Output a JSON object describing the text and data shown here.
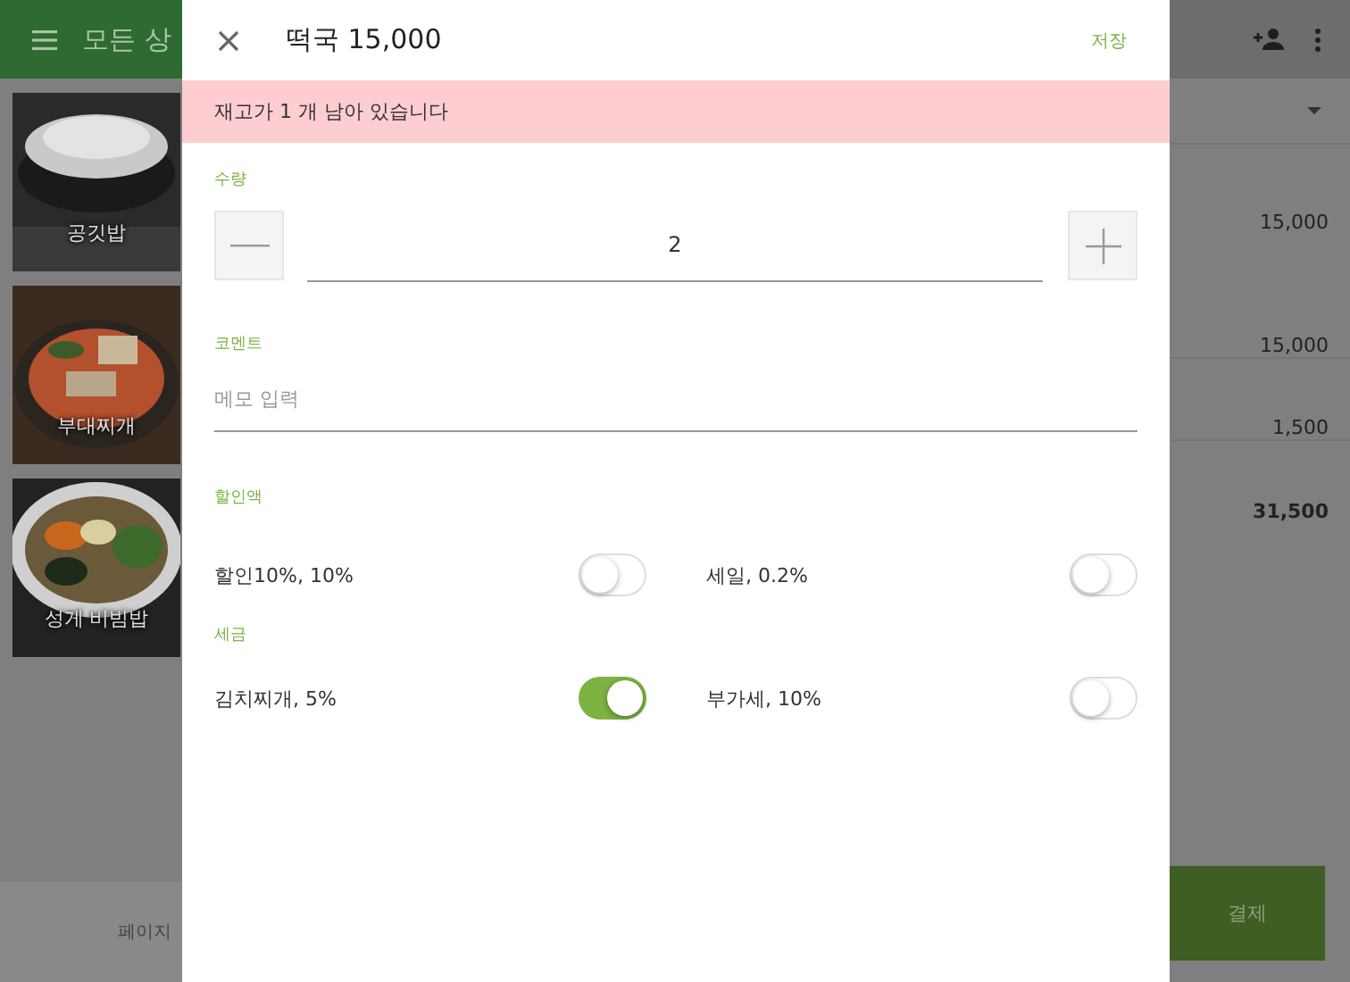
{
  "background": {
    "app_title": "모든 상",
    "products": [
      {
        "name": "공깃밥"
      },
      {
        "name": "부대찌개"
      },
      {
        "name": "성게 비빔밥"
      }
    ],
    "page_label": "페이지",
    "amounts": [
      "15,000",
      "15,000",
      "1,500"
    ],
    "total": "31,500",
    "pay_button": "결제"
  },
  "dialog": {
    "title": "떡국 15,000",
    "save": "저장",
    "stock_notice": "재고가 1 개 남아 있습니다",
    "quantity": {
      "label": "수량",
      "value": "2"
    },
    "comment": {
      "label": "코멘트",
      "placeholder": "메모 입력"
    },
    "sections": [
      {
        "title": "할인액",
        "options": [
          {
            "label": "할인10%, 10%",
            "on": false
          },
          {
            "label": "세일, 0.2%",
            "on": false
          }
        ]
      },
      {
        "title": "세금",
        "options": [
          {
            "label": "김치찌개, 5%",
            "on": true
          },
          {
            "label": "부가세, 10%",
            "on": false
          }
        ]
      }
    ]
  }
}
